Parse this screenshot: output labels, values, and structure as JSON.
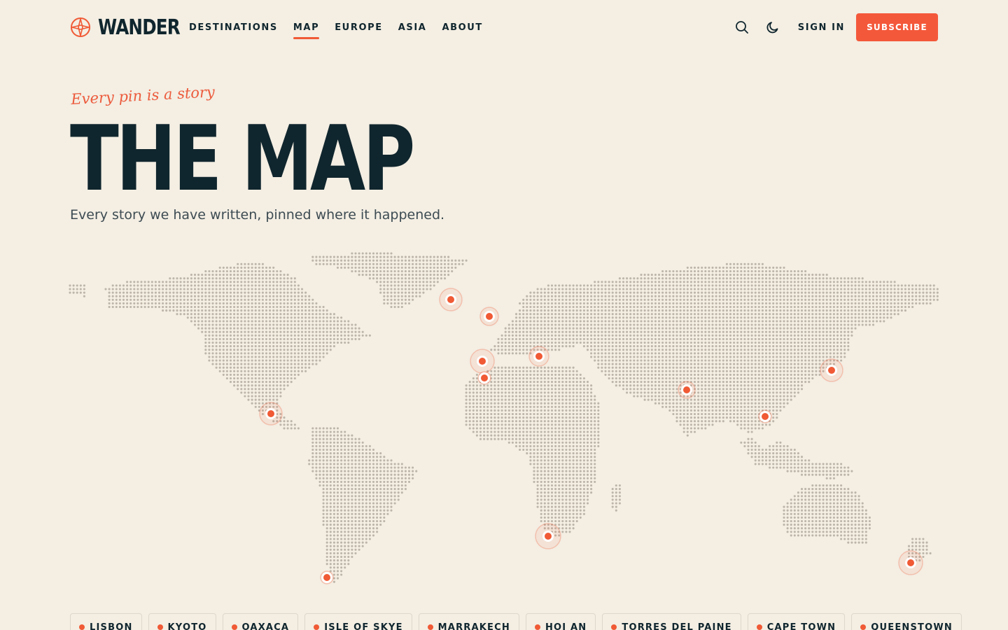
{
  "brand": {
    "name": "WANDER",
    "accent": "#f05a35",
    "ink": "#10262e",
    "background": "#f4eee3"
  },
  "nav": {
    "items": [
      {
        "label": "DESTINATIONS",
        "active": false
      },
      {
        "label": "MAP",
        "active": true
      },
      {
        "label": "EUROPE",
        "active": false
      },
      {
        "label": "ASIA",
        "active": false
      },
      {
        "label": "ABOUT",
        "active": false
      }
    ]
  },
  "header": {
    "search_icon": "search-icon",
    "theme_icon": "moon-icon",
    "sign_in_label": "SIGN IN",
    "subscribe_label": "SUBSCRIBE"
  },
  "hero": {
    "tagline": "Every pin is a story",
    "title": "THE MAP",
    "subtitle": "Every story we have written, pinned where it happened."
  },
  "map": {
    "pins": [
      {
        "id": "skye"
      },
      {
        "id": "ireland"
      },
      {
        "id": "paris"
      },
      {
        "id": "lisbon"
      },
      {
        "id": "athens"
      },
      {
        "id": "india"
      },
      {
        "id": "kyoto"
      },
      {
        "id": "hoi-an"
      },
      {
        "id": "oaxaca"
      },
      {
        "id": "cape-town"
      },
      {
        "id": "torres-del-paine"
      },
      {
        "id": "queenstown"
      }
    ]
  },
  "destinations": [
    "LISBON",
    "KYOTO",
    "OAXACA",
    "ISLE OF SKYE",
    "MARRAKECH",
    "HOI AN",
    "TORRES DEL PAINE",
    "CAPE TOWN",
    "QUEENSTOWN"
  ]
}
